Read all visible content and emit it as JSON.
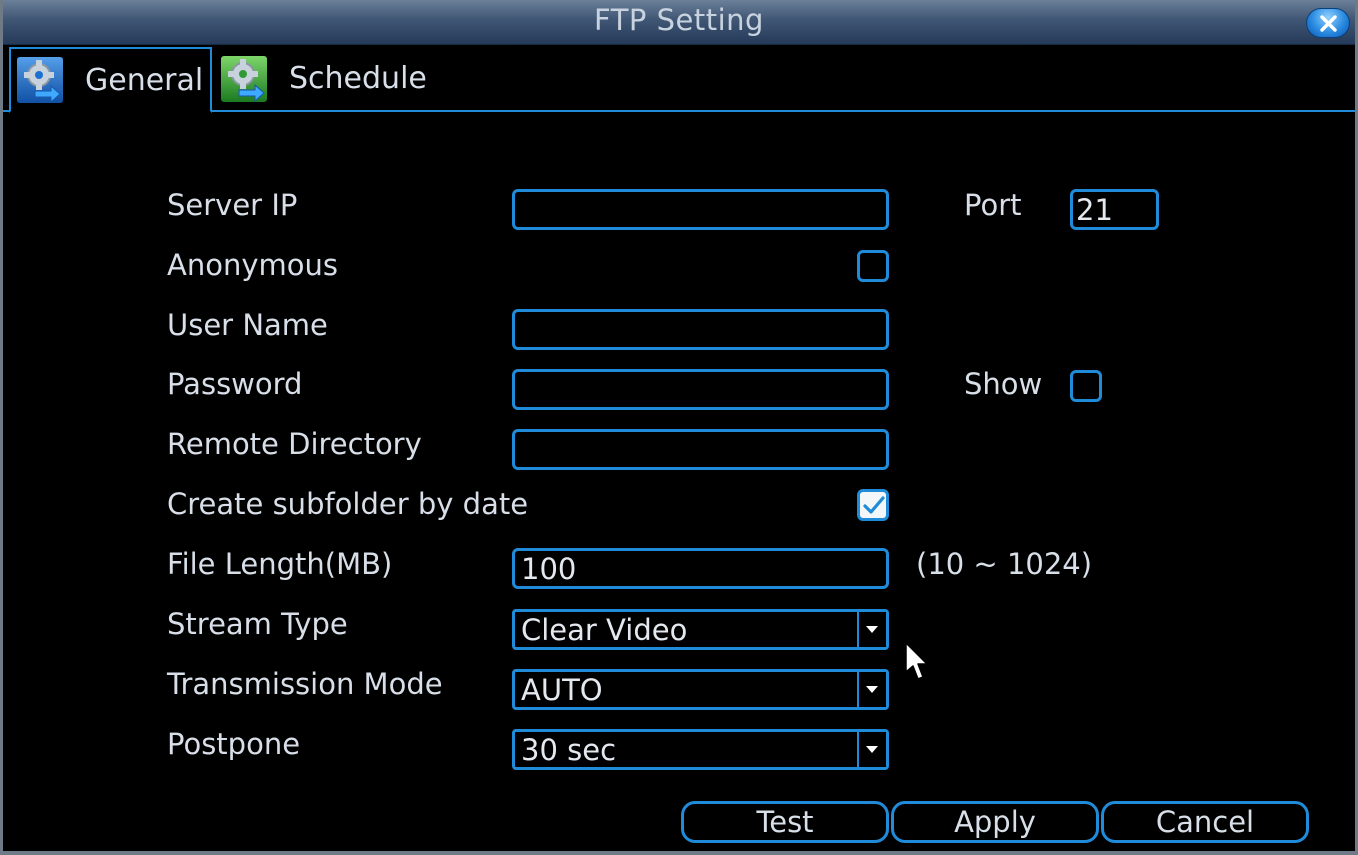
{
  "window": {
    "title": "FTP Setting",
    "close_icon": "close-icon"
  },
  "tabs": [
    {
      "label": "General",
      "icon": "settings-gear-arrow-icon",
      "active": true
    },
    {
      "label": "Schedule",
      "icon": "settings-gear-arrow-icon",
      "active": false
    }
  ],
  "form": {
    "server_ip": {
      "label": "Server IP",
      "value": ""
    },
    "port": {
      "label": "Port",
      "value": "21"
    },
    "anonymous": {
      "label": "Anonymous",
      "checked": false
    },
    "user_name": {
      "label": "User Name",
      "value": ""
    },
    "password": {
      "label": "Password",
      "value": ""
    },
    "show": {
      "label": "Show",
      "checked": false
    },
    "remote_directory": {
      "label": "Remote Directory",
      "value": ""
    },
    "create_subfolder": {
      "label": "Create subfolder by date",
      "checked": true
    },
    "file_length": {
      "label": "File Length(MB)",
      "value": "100",
      "range": "(10 ~ 1024)"
    },
    "stream_type": {
      "label": "Stream Type",
      "value": "Clear Video"
    },
    "transmission_mode": {
      "label": "Transmission Mode",
      "value": "AUTO"
    },
    "postpone": {
      "label": "Postpone",
      "value": "30 sec"
    }
  },
  "buttons": {
    "test": "Test",
    "apply": "Apply",
    "cancel": "Cancel"
  },
  "colors": {
    "accent": "#1f8bd9",
    "background": "#000000",
    "title_bar": "#3f5674",
    "text": "#d8dfe8"
  }
}
